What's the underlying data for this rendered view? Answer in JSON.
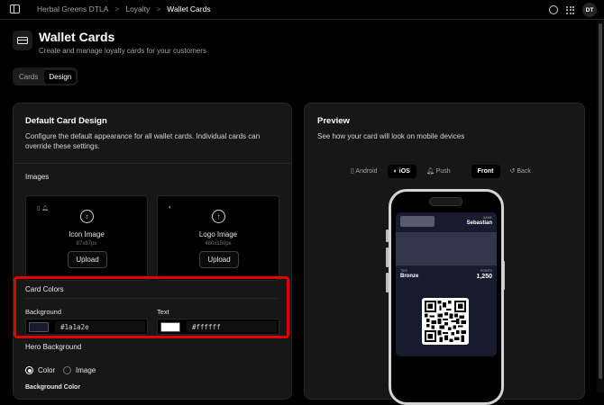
{
  "breadcrumb": {
    "org": "Herbal Greens DTLA",
    "section": "Loyalty",
    "current": "Wallet Cards",
    "sep": ">"
  },
  "user": {
    "initials": "DT"
  },
  "header": {
    "title": "Wallet Cards",
    "subtitle": "Create and manage loyalty cards for your customers"
  },
  "tabs": [
    {
      "label": "Cards"
    },
    {
      "label": "Design"
    }
  ],
  "design": {
    "title": "Default Card Design",
    "description": "Configure the default appearance for all wallet cards. Individual cards can override these settings.",
    "images_label": "Images",
    "icon_image": {
      "name": "Icon Image",
      "size": "87x87px",
      "upload": "Upload"
    },
    "logo_image": {
      "name": "Logo Image",
      "size": "480x150px",
      "upload": "Upload"
    },
    "card_colors": {
      "title": "Card Colors",
      "background_label": "Background",
      "background_value": "#1a1a2e",
      "text_label": "Text",
      "text_value": "#ffffff"
    },
    "hero": {
      "title": "Hero Background",
      "option_color": "Color",
      "option_image": "Image",
      "selected": "Color"
    },
    "bg_color_label": "Background Color"
  },
  "preview": {
    "title": "Preview",
    "description": "See how your card will look on mobile devices",
    "platforms": [
      "Android",
      "iOS",
      "Push"
    ],
    "active_platform": "iOS",
    "sides": [
      "Front",
      "Back"
    ],
    "active_side": "Front",
    "card": {
      "name_label": "NAME",
      "name": "Sebastian",
      "tier_label": "TIER",
      "tier": "Bronze",
      "points_label": "POINTS",
      "points": "1,250"
    }
  },
  "colors": {
    "accent": "#e00000",
    "card_bg": "#1a1a2e",
    "hero": "#35354e"
  }
}
